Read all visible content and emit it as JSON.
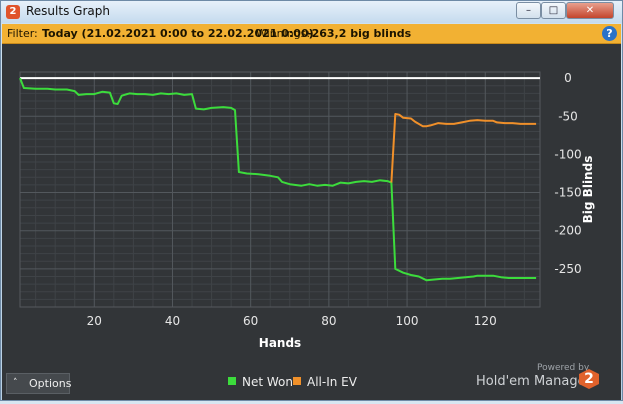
{
  "window": {
    "title": "Results Graph",
    "app_icon_text": "2",
    "minimize_glyph": "–",
    "maximize_glyph": "□",
    "close_glyph": "✕"
  },
  "filter": {
    "label": "Filter:",
    "value": "Today (21.02.2021 0:00 to 22.02.2021 0:00)",
    "winnings_label": "Winnings:",
    "winnings_value": "-263,2 big blinds",
    "help_glyph": "?"
  },
  "options": {
    "label": "Options",
    "chevron": "˄"
  },
  "branding": {
    "powered_by": "Powered by",
    "name": "Hold'em Manager",
    "badge": "2"
  },
  "colors": {
    "net_won": "#3cdc3c",
    "all_in_ev": "#f0902a",
    "zero_line": "#ffffff",
    "background": "#323538",
    "grid": "#4a4e52"
  },
  "chart_data": {
    "type": "line",
    "xlabel": "Hands",
    "ylabel": "Big Blinds",
    "xlim": [
      1,
      134
    ],
    "ylim": [
      -300,
      8
    ],
    "x_ticks": [
      20,
      40,
      60,
      80,
      100,
      120
    ],
    "y_ticks": [
      0,
      -50,
      -100,
      -150,
      -200,
      -250
    ],
    "zero_line": true,
    "grid": true,
    "legend_position": "bottom-center",
    "series": [
      {
        "name": "Net Won",
        "color": "#3cdc3c",
        "points": [
          [
            1,
            0
          ],
          [
            2,
            -13
          ],
          [
            5,
            -14
          ],
          [
            8,
            -14
          ],
          [
            10,
            -15
          ],
          [
            13,
            -15
          ],
          [
            15,
            -17
          ],
          [
            16,
            -22
          ],
          [
            18,
            -21
          ],
          [
            20,
            -21
          ],
          [
            22,
            -18
          ],
          [
            24,
            -19
          ],
          [
            25,
            -33
          ],
          [
            26,
            -34
          ],
          [
            27,
            -23
          ],
          [
            29,
            -20
          ],
          [
            31,
            -21
          ],
          [
            33,
            -21
          ],
          [
            35,
            -22
          ],
          [
            37,
            -20
          ],
          [
            39,
            -21
          ],
          [
            41,
            -20
          ],
          [
            43,
            -22
          ],
          [
            45,
            -21
          ],
          [
            46,
            -40
          ],
          [
            48,
            -41
          ],
          [
            50,
            -39
          ],
          [
            53,
            -38
          ],
          [
            55,
            -39
          ],
          [
            56,
            -42
          ],
          [
            57,
            -123
          ],
          [
            59,
            -125
          ],
          [
            62,
            -126
          ],
          [
            65,
            -128
          ],
          [
            67,
            -130
          ],
          [
            68,
            -136
          ],
          [
            70,
            -139
          ],
          [
            73,
            -141
          ],
          [
            75,
            -139
          ],
          [
            77,
            -141
          ],
          [
            79,
            -140
          ],
          [
            81,
            -141
          ],
          [
            83,
            -137
          ],
          [
            85,
            -138
          ],
          [
            87,
            -136
          ],
          [
            89,
            -135
          ],
          [
            91,
            -136
          ],
          [
            93,
            -134
          ],
          [
            95,
            -135
          ],
          [
            96,
            -137
          ],
          [
            97,
            -250
          ],
          [
            99,
            -255
          ],
          [
            101,
            -258
          ],
          [
            103,
            -260
          ],
          [
            105,
            -265
          ],
          [
            107,
            -264
          ],
          [
            109,
            -263
          ],
          [
            111,
            -263
          ],
          [
            113,
            -262
          ],
          [
            115,
            -261
          ],
          [
            117,
            -260
          ],
          [
            118,
            -259
          ],
          [
            120,
            -259
          ],
          [
            122,
            -259
          ],
          [
            124,
            -261
          ],
          [
            126,
            -262
          ],
          [
            128,
            -262
          ],
          [
            130,
            -262
          ],
          [
            132,
            -262
          ],
          [
            133,
            -262
          ]
        ]
      },
      {
        "name": "All-In EV",
        "color": "#f0902a",
        "points": [
          [
            96,
            -137
          ],
          [
            97,
            -47
          ],
          [
            98,
            -48
          ],
          [
            99,
            -52
          ],
          [
            101,
            -53
          ],
          [
            102,
            -57
          ],
          [
            104,
            -63
          ],
          [
            105,
            -63
          ],
          [
            106,
            -62
          ],
          [
            108,
            -59
          ],
          [
            110,
            -60
          ],
          [
            112,
            -60
          ],
          [
            114,
            -58
          ],
          [
            116,
            -56
          ],
          [
            118,
            -55
          ],
          [
            120,
            -56
          ],
          [
            122,
            -56
          ],
          [
            123,
            -58
          ],
          [
            125,
            -59
          ],
          [
            127,
            -59
          ],
          [
            129,
            -60
          ],
          [
            131,
            -60
          ],
          [
            133,
            -60
          ]
        ]
      }
    ]
  }
}
